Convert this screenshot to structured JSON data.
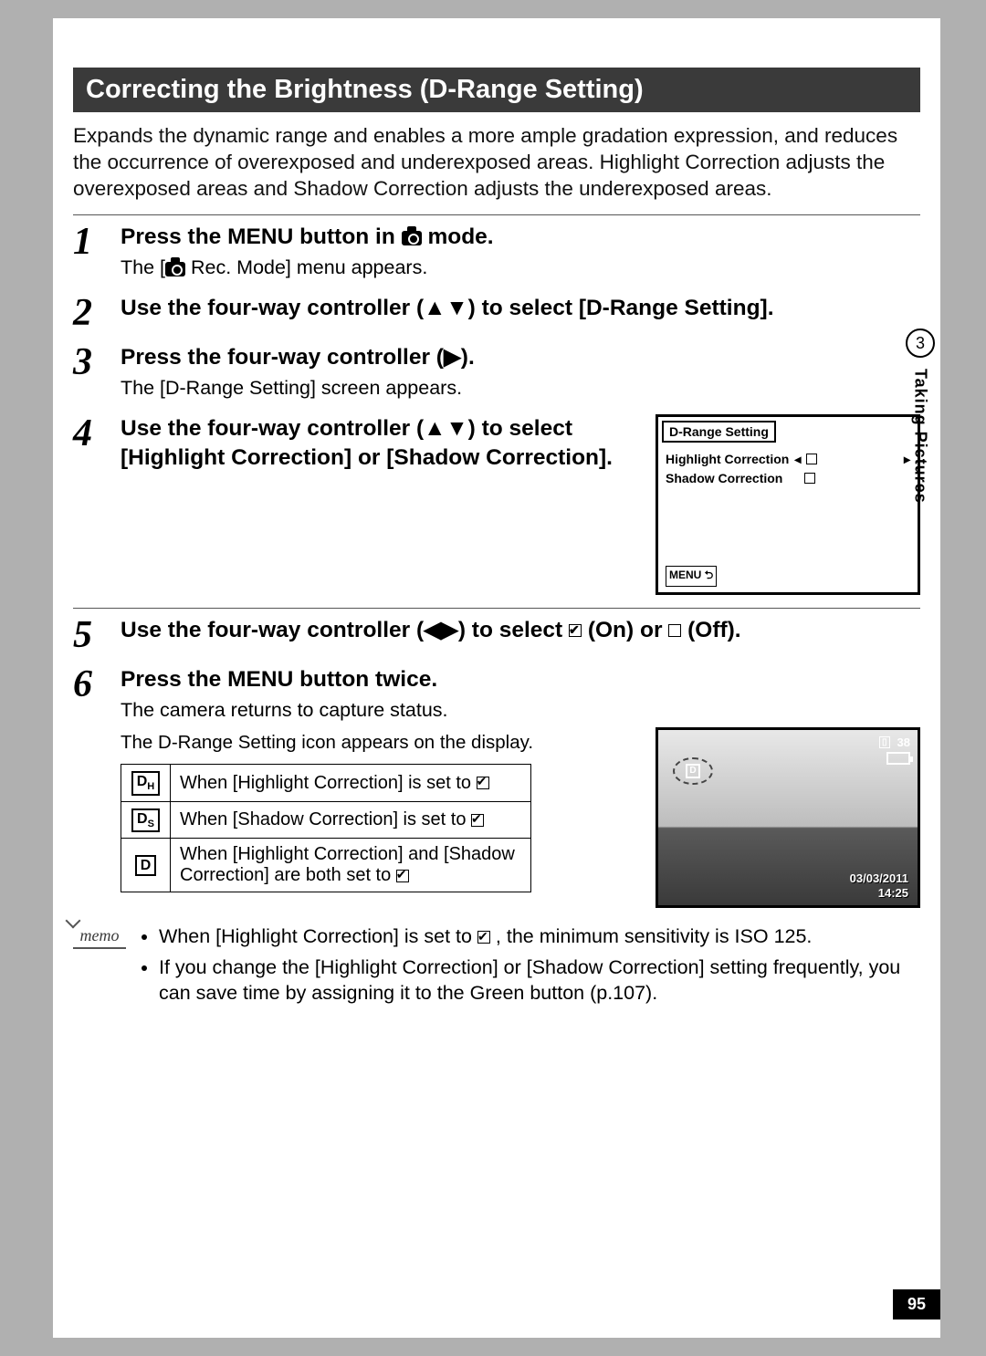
{
  "section_title": "Correcting the Brightness (D-Range Setting)",
  "intro": "Expands the dynamic range and enables a more ample gradation expression, and reduces the occurrence of overexposed and underexposed areas. Highlight Correction adjusts the overexposed areas and Shadow Correction adjusts the underexposed areas.",
  "steps": {
    "s1": {
      "num": "1",
      "bold_pre": "Press the ",
      "bold_menu": "MENU",
      "bold_post": " button in ",
      "bold_end": " mode.",
      "desc_pre": "The [",
      "desc_post": " Rec. Mode] menu appears."
    },
    "s2": {
      "num": "2",
      "bold": "Use the four-way controller (▲▼) to select [D-Range Setting]."
    },
    "s3": {
      "num": "3",
      "bold": "Press the four-way controller (▶).",
      "desc": "The [D-Range Setting] screen appears."
    },
    "s4": {
      "num": "4",
      "bold": "Use the four-way controller (▲▼) to select [Highlight Correction] or [Shadow Correction].",
      "lcd": {
        "title": "D-Range Setting",
        "row1": "Highlight Correction",
        "row2": "Shadow Correction",
        "menu": "MENU"
      }
    },
    "s5": {
      "num": "5",
      "bold_pre": "Use the four-way controller (◀▶) to select ",
      "bold_mid": " (On) or ",
      "bold_end": " (Off)."
    },
    "s6": {
      "num": "6",
      "bold_pre": "Press the ",
      "bold_menu": "MENU",
      "bold_post": " button twice.",
      "desc1": "The camera returns to capture status.",
      "desc2": "The D-Range Setting icon appears on the display."
    }
  },
  "icon_table": {
    "r1": {
      "text_pre": "When [Highlight Correction] is set to "
    },
    "r2": {
      "text_pre": "When [Shadow Correction] is set to "
    },
    "r3": {
      "text_pre": "When [Highlight Correction] and [Shadow Correction] are both set to "
    }
  },
  "camera_display": {
    "count": "38",
    "date": "03/03/2011",
    "time": "14:25",
    "dlabel": "D"
  },
  "memo": {
    "label": "memo",
    "b1_pre": "When [Highlight Correction] is set to ",
    "b1_post": " , the minimum sensitivity is ISO 125.",
    "b2": "If you change the [Highlight Correction] or [Shadow Correction] setting frequently, you can save time by assigning it to the Green button (p.107)."
  },
  "side": {
    "chapter": "3",
    "label": "Taking Pictures"
  },
  "page_number": "95"
}
